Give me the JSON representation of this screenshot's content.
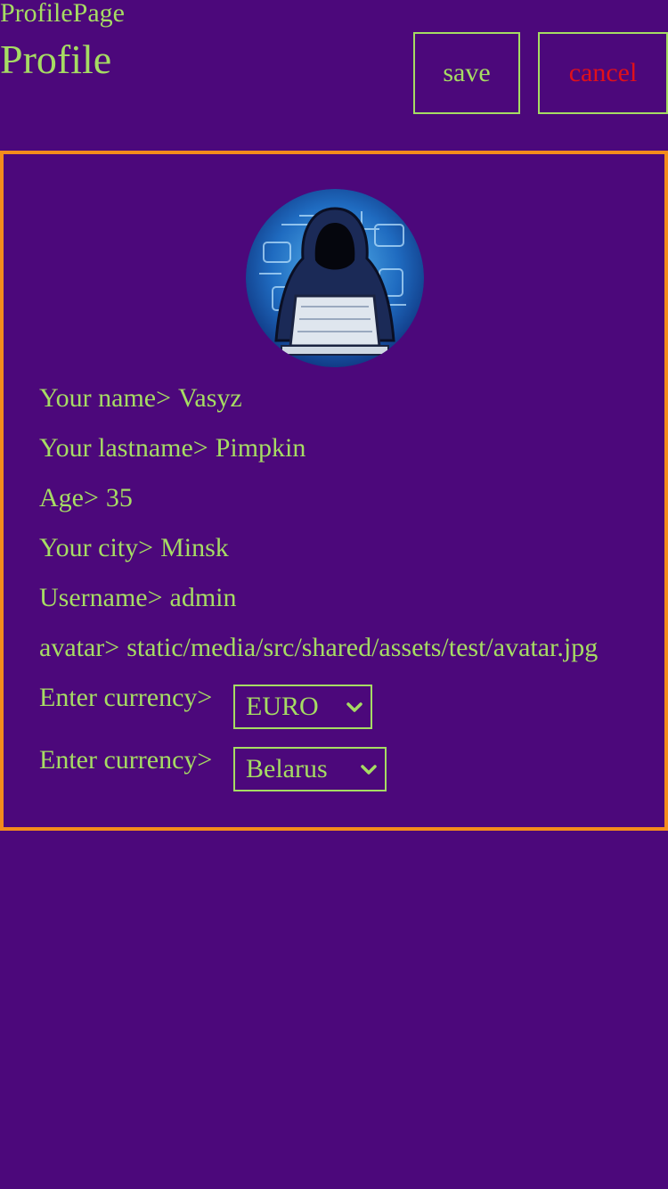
{
  "header": {
    "page_label": "ProfilePage",
    "title": "Profile",
    "save_label": "save",
    "cancel_label": "cancel"
  },
  "profile": {
    "avatar_icon": "hooded-hacker-avatar",
    "fields": {
      "name": {
        "label": "Your name>",
        "value": "Vasyz"
      },
      "lastname": {
        "label": "Your lastname>",
        "value": "Pimpkin"
      },
      "age": {
        "label": "Age>",
        "value": "35"
      },
      "city": {
        "label": "Your city>",
        "value": "Minsk"
      },
      "username": {
        "label": "Username>",
        "value": "admin"
      },
      "avatar": {
        "label": "avatar>",
        "value": "static/media/src/shared/assets/test/avatar.jpg"
      }
    },
    "currency_select": {
      "label": "Enter currency>",
      "value": "EURO"
    },
    "country_select": {
      "label": "Enter currency>",
      "value": "Belarus"
    }
  },
  "colors": {
    "background": "#4c087b",
    "text": "#a6dc63",
    "cancel": "#e0101a",
    "card_border": "#f48c1c"
  }
}
